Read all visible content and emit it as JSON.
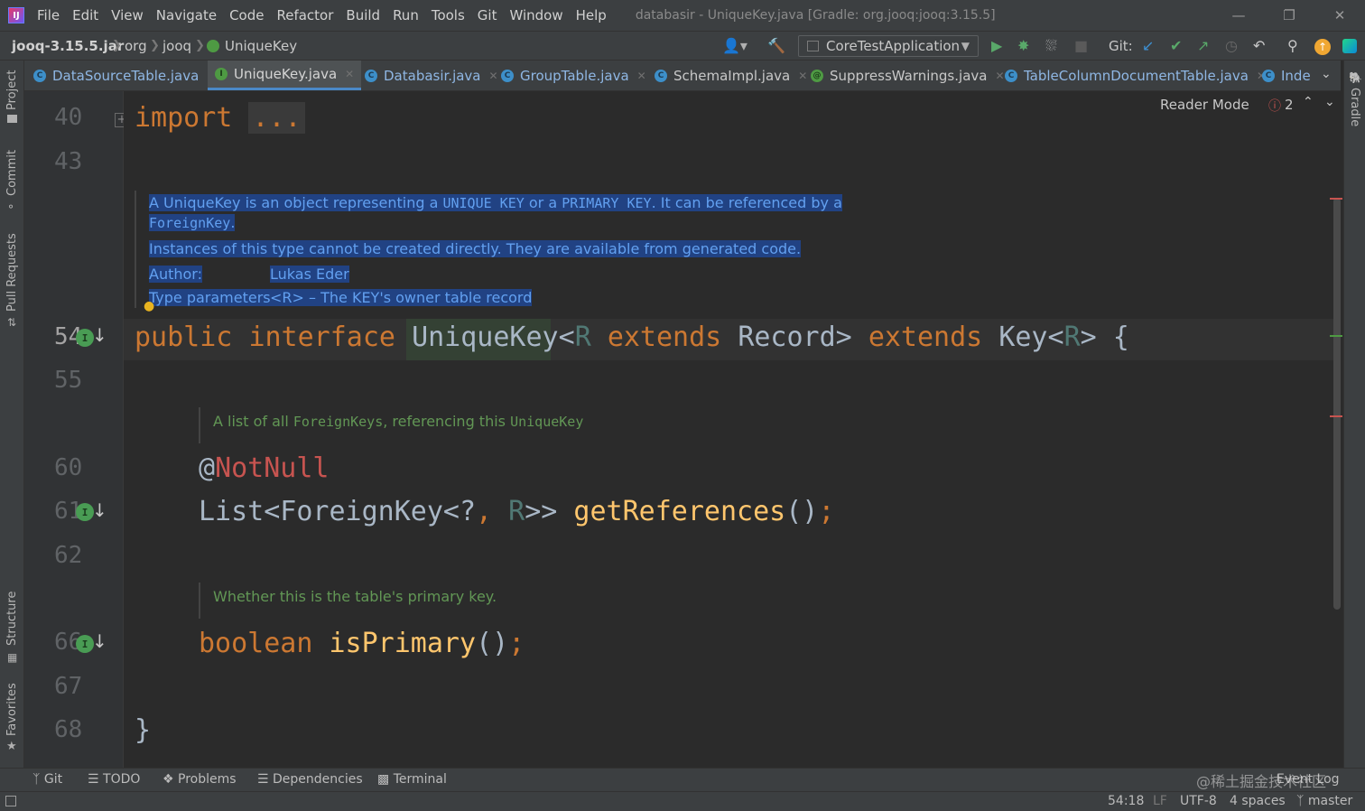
{
  "menubar": {
    "items": [
      "File",
      "Edit",
      "View",
      "Navigate",
      "Code",
      "Refactor",
      "Build",
      "Run",
      "Tools",
      "Git",
      "Window",
      "Help"
    ],
    "window_title": "databasir - UniqueKey.java [Gradle: org.jooq:jooq:3.15.5]"
  },
  "breadcrumb": {
    "jar": "jooq-3.15.5.jar",
    "pkg1": "org",
    "pkg2": "jooq",
    "cls": "UniqueKey"
  },
  "toolbar": {
    "run_config": "CoreTestApplication",
    "git_label": "Git:"
  },
  "tabs": [
    {
      "label": "DataSourceTable.java"
    },
    {
      "label": "UniqueKey.java"
    },
    {
      "label": "Databasir.java"
    },
    {
      "label": "GroupTable.java"
    },
    {
      "label": "SchemaImpl.java"
    },
    {
      "label": "SuppressWarnings.java"
    },
    {
      "label": "TableColumnDocumentTable.java"
    },
    {
      "label": "Inde"
    }
  ],
  "side": {
    "project": "Project",
    "commit": "Commit",
    "pull_requests": "Pull Requests",
    "structure": "Structure",
    "favorites": "Favorites",
    "gradle": "Gradle"
  },
  "editor": {
    "reader_mode": "Reader Mode",
    "error_count": "2",
    "line_numbers": [
      "40",
      "43",
      "54",
      "55",
      "60",
      "61",
      "62",
      "66",
      "67",
      "68"
    ],
    "import_kw": "import",
    "import_fold": "...",
    "doc1_a": "A UniqueKey is an object representing a ",
    "doc1_b": "UNIQUE KEY",
    "doc1_c": " or a ",
    "doc1_d": "PRIMARY KEY",
    "doc1_e": ". It can be referenced by a",
    "doc1_f": "ForeignKey",
    "doc1_g": ".",
    "doc2": "Instances of this type cannot be created directly. They are available from generated code.",
    "author_label": "Author:",
    "author_value": "Lukas Eder",
    "typeparam_label": "Type parameters:",
    "typeparam_value": "<R> – The KEY's owner table record",
    "line54": {
      "kw1": "public",
      "kw2": "interface",
      "name": "UniqueKey",
      "lt": "<",
      "r1": "R",
      "kw3": "extends",
      "rec": "Record>",
      "kw4": "extends",
      "key": "Key<",
      "r2": "R",
      "tail": "> {"
    },
    "doc3_a": "A list of all ",
    "doc3_b": "ForeignKeys",
    "doc3_c": ", referencing this ",
    "doc3_d": "UniqueKey",
    "line60": {
      "at": "@",
      "ann": "NotNull"
    },
    "line61": {
      "a": "List<ForeignKey<?",
      "comma": ",",
      "r": " R",
      "b": ">> ",
      "fn": "getReferences",
      "c": "()",
      "semi": ";"
    },
    "doc4": "Whether this is the table's primary key.",
    "line66": {
      "kw": "boolean",
      "fn": "isPrimary",
      "c": "()",
      "semi": ";"
    },
    "line68": "}"
  },
  "toolwindows": {
    "git": "Git",
    "todo": "TODO",
    "problems": "Problems",
    "dependencies": "Dependencies",
    "terminal": "Terminal",
    "event_log": "Event Log",
    "watermark": "@稀土掘金技术社区"
  },
  "status": {
    "position": "54:18",
    "lf": "LF",
    "encoding": "UTF-8",
    "indent": "4 spaces",
    "branch": "master"
  }
}
